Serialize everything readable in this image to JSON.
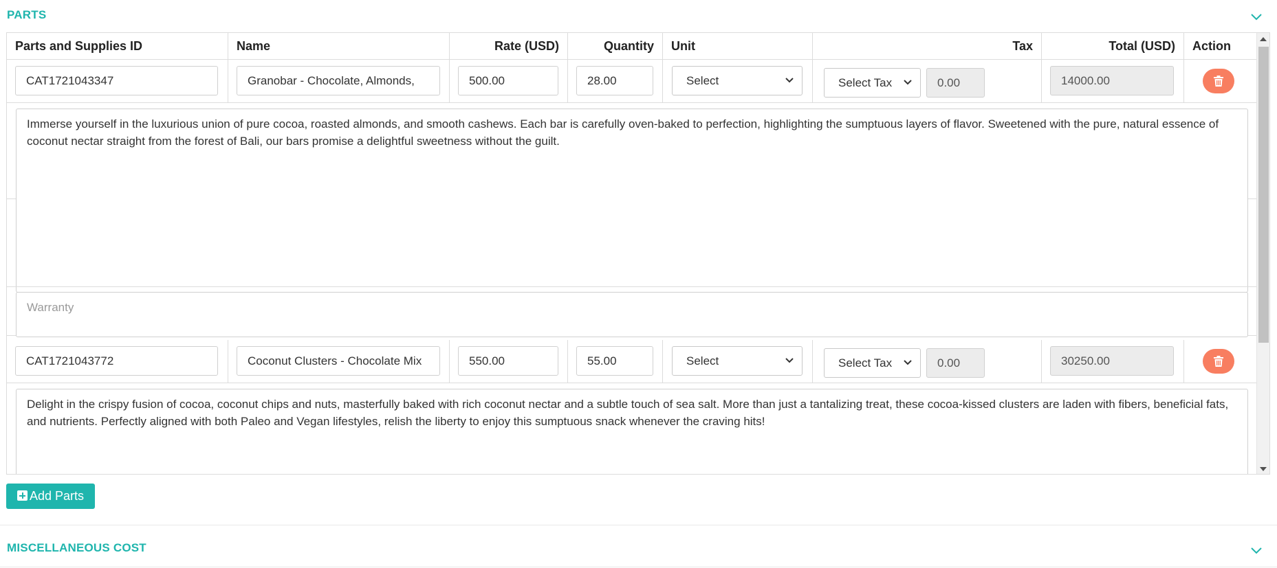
{
  "parts_section": {
    "title": "PARTS",
    "columns": {
      "id": "Parts and Supplies ID",
      "name": "Name",
      "rate": "Rate (USD)",
      "quantity": "Quantity",
      "unit": "Unit",
      "tax": "Tax",
      "total": "Total (USD)",
      "action": "Action"
    },
    "items": [
      {
        "id": "CAT1721043347",
        "name": "Granobar - Chocolate, Almonds,",
        "rate": "500.00",
        "quantity": "28.00",
        "unit": "Select",
        "tax_select": "Select Tax",
        "tax_value": "0.00",
        "total": "14000.00",
        "description": "Immerse yourself in the luxurious union of pure cocoa, roasted almonds, and smooth cashews. Each bar is carefully oven-baked to perfection, highlighting the sumptuous layers of flavor. Sweetened with the pure, natural essence of coconut nectar straight from the forest of Bali, our bars promise a delightful sweetness without the guilt.",
        "warranty_placeholder": "Warranty"
      },
      {
        "id": "CAT1721043772",
        "name": "Coconut Clusters - Chocolate Mix",
        "rate": "550.00",
        "quantity": "55.00",
        "unit": "Select",
        "tax_select": "Select Tax",
        "tax_value": "0.00",
        "total": "30250.00",
        "description": "Delight in the crispy fusion of cocoa, coconut chips and nuts, masterfully baked with rich coconut nectar and a subtle touch of sea salt. More than just a tantalizing treat, these cocoa-kissed clusters are laden with fibers, beneficial fats, and nutrients. Perfectly aligned with both Paleo and Vegan lifestyles, relish the liberty to enjoy this sumptuous snack whenever the craving hits!"
      }
    ],
    "add_button_label": "Add Parts"
  },
  "misc_section": {
    "title": "MISCELLANEOUS COST"
  },
  "icons": {
    "chevron": "chevron-down-icon",
    "trash": "trash-icon",
    "plus": "plus-square-icon"
  },
  "colors": {
    "accent": "#1fb5ad",
    "delete": "#f87e60"
  }
}
